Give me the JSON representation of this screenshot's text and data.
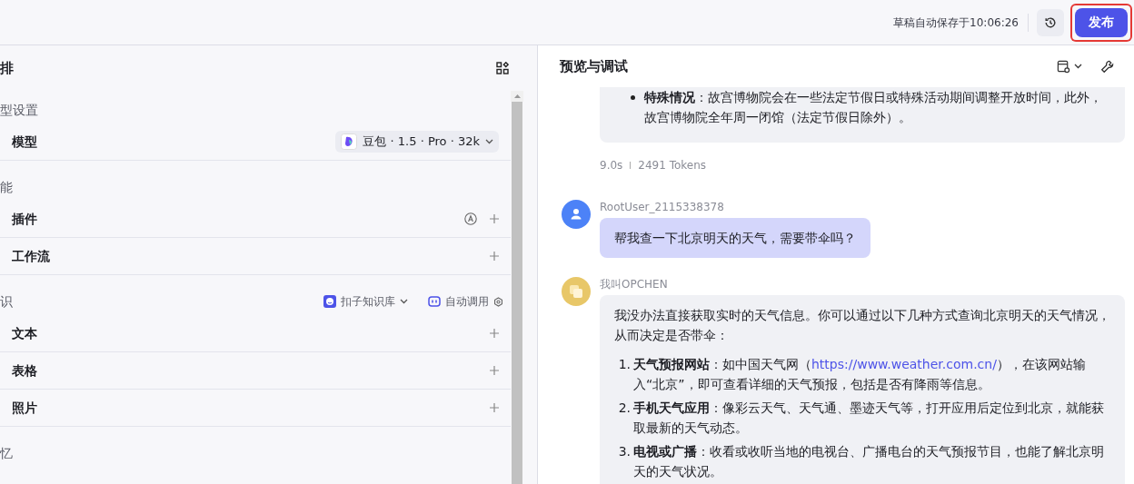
{
  "topbar": {
    "save_status": "草稿自动保存于10:06:26",
    "publish": {
      "label": "发布",
      "highlighted": true
    }
  },
  "left_panel": {
    "title": "排",
    "sections": [
      {
        "title": "型设置",
        "kind": "model",
        "items": [
          {
            "label": "模型",
            "model": "豆包 · 1.5 · Pro · 32k"
          }
        ]
      },
      {
        "title": "能",
        "kind": "plain",
        "items": [
          {
            "label": "插件",
            "auto": true
          },
          {
            "label": "工作流",
            "auto": false
          }
        ]
      },
      {
        "title": "识",
        "kind": "knowledge",
        "source": "扣子知识库",
        "mode": "自动调用",
        "items": [
          {
            "label": "文本",
            "auto": false
          },
          {
            "label": "表格",
            "auto": false
          },
          {
            "label": "照片",
            "auto": false
          }
        ]
      },
      {
        "title": "忆",
        "kind": "plain"
      }
    ]
  },
  "preview": {
    "title": "预览与调试",
    "prev_answer": {
      "bullet": "**特殊情况**：故宫博物院会在一些法定节假日或特殊活动期间调整开放时间，此外，故宫博物院全年周一闭馆（法定节假日除外）。",
      "time": "9.0s",
      "tokens": "2491 Tokens"
    },
    "messages": [
      {
        "kind": "user",
        "name": "RootUser_2115338378",
        "text": "帮我查一下北京明天的天气，需要带伞吗？"
      },
      {
        "kind": "bot",
        "name": "我叫OPCHEN",
        "intro": "我没办法直接获取实时的天气信息。你可以通过以下几种方式查询北京明天的天气情况，从而决定是否带伞：",
        "list": [
          {
            "number": "1.",
            "title": "天气预报网站",
            "before": "：如中国天气网（",
            "link": "https://www.weather.com.cn/",
            "after": "），在该网站输入“北京”，即可查看详细的天气预报，包括是否有降雨等信息。"
          },
          {
            "number": "2.",
            "title": "手机天气应用",
            "before": "：像彩云天气、天气通、墨迹天气等，打开应用后定位到北京，就能获取最新的天气动态。"
          },
          {
            "number": "3.",
            "title": "电视或广播",
            "before": "：收看或收听当地的电视台、广播电台的天气预报节目，也能了解北京明天的天气状况。"
          }
        ]
      }
    ]
  }
}
